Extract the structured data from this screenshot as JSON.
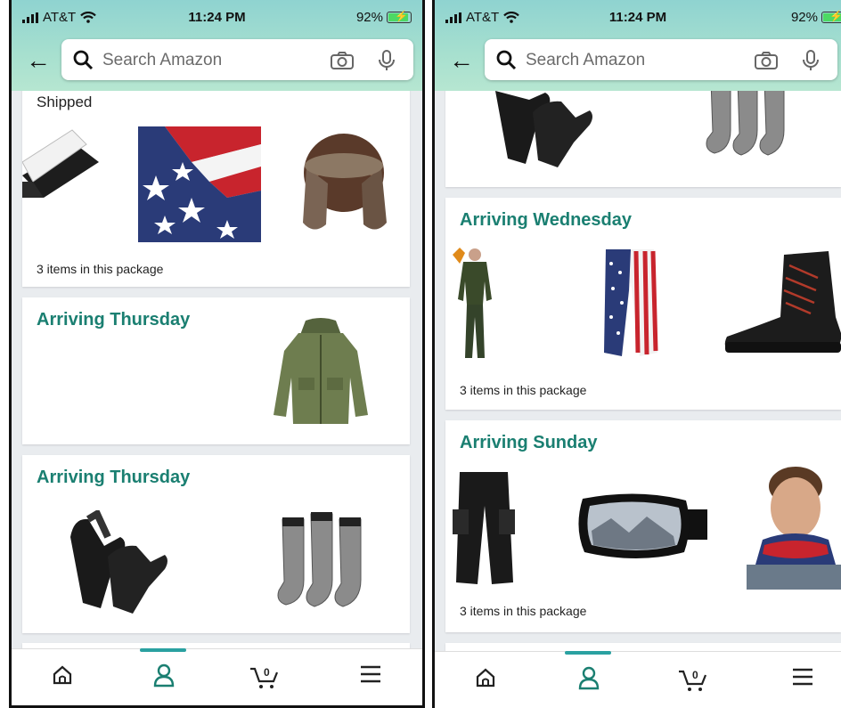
{
  "status_bar": {
    "carrier": "AT&T",
    "time": "11:24 PM",
    "battery": "92%"
  },
  "search": {
    "placeholder": "Search Amazon"
  },
  "left_screen": {
    "shipped_label": "Shipped",
    "packages": [
      {
        "items_count": "3 items in this package"
      },
      {
        "title": "Arriving Thursday"
      },
      {
        "title": "Arriving Thursday"
      }
    ]
  },
  "right_screen": {
    "packages": [
      {
        "title": "Arriving Wednesday",
        "items_count": "3 items in this package"
      },
      {
        "title": "Arriving Sunday",
        "items_count": "3 items in this package"
      }
    ]
  },
  "bottom_nav": {
    "items": [
      "home-icon",
      "account-icon",
      "cart-icon",
      "menu-icon"
    ],
    "active": "account-icon",
    "cart_count": "0"
  },
  "colors": {
    "accent": "#1a7f71",
    "header": "#a7e0cf",
    "nav_indicator": "#2aa1a1"
  }
}
